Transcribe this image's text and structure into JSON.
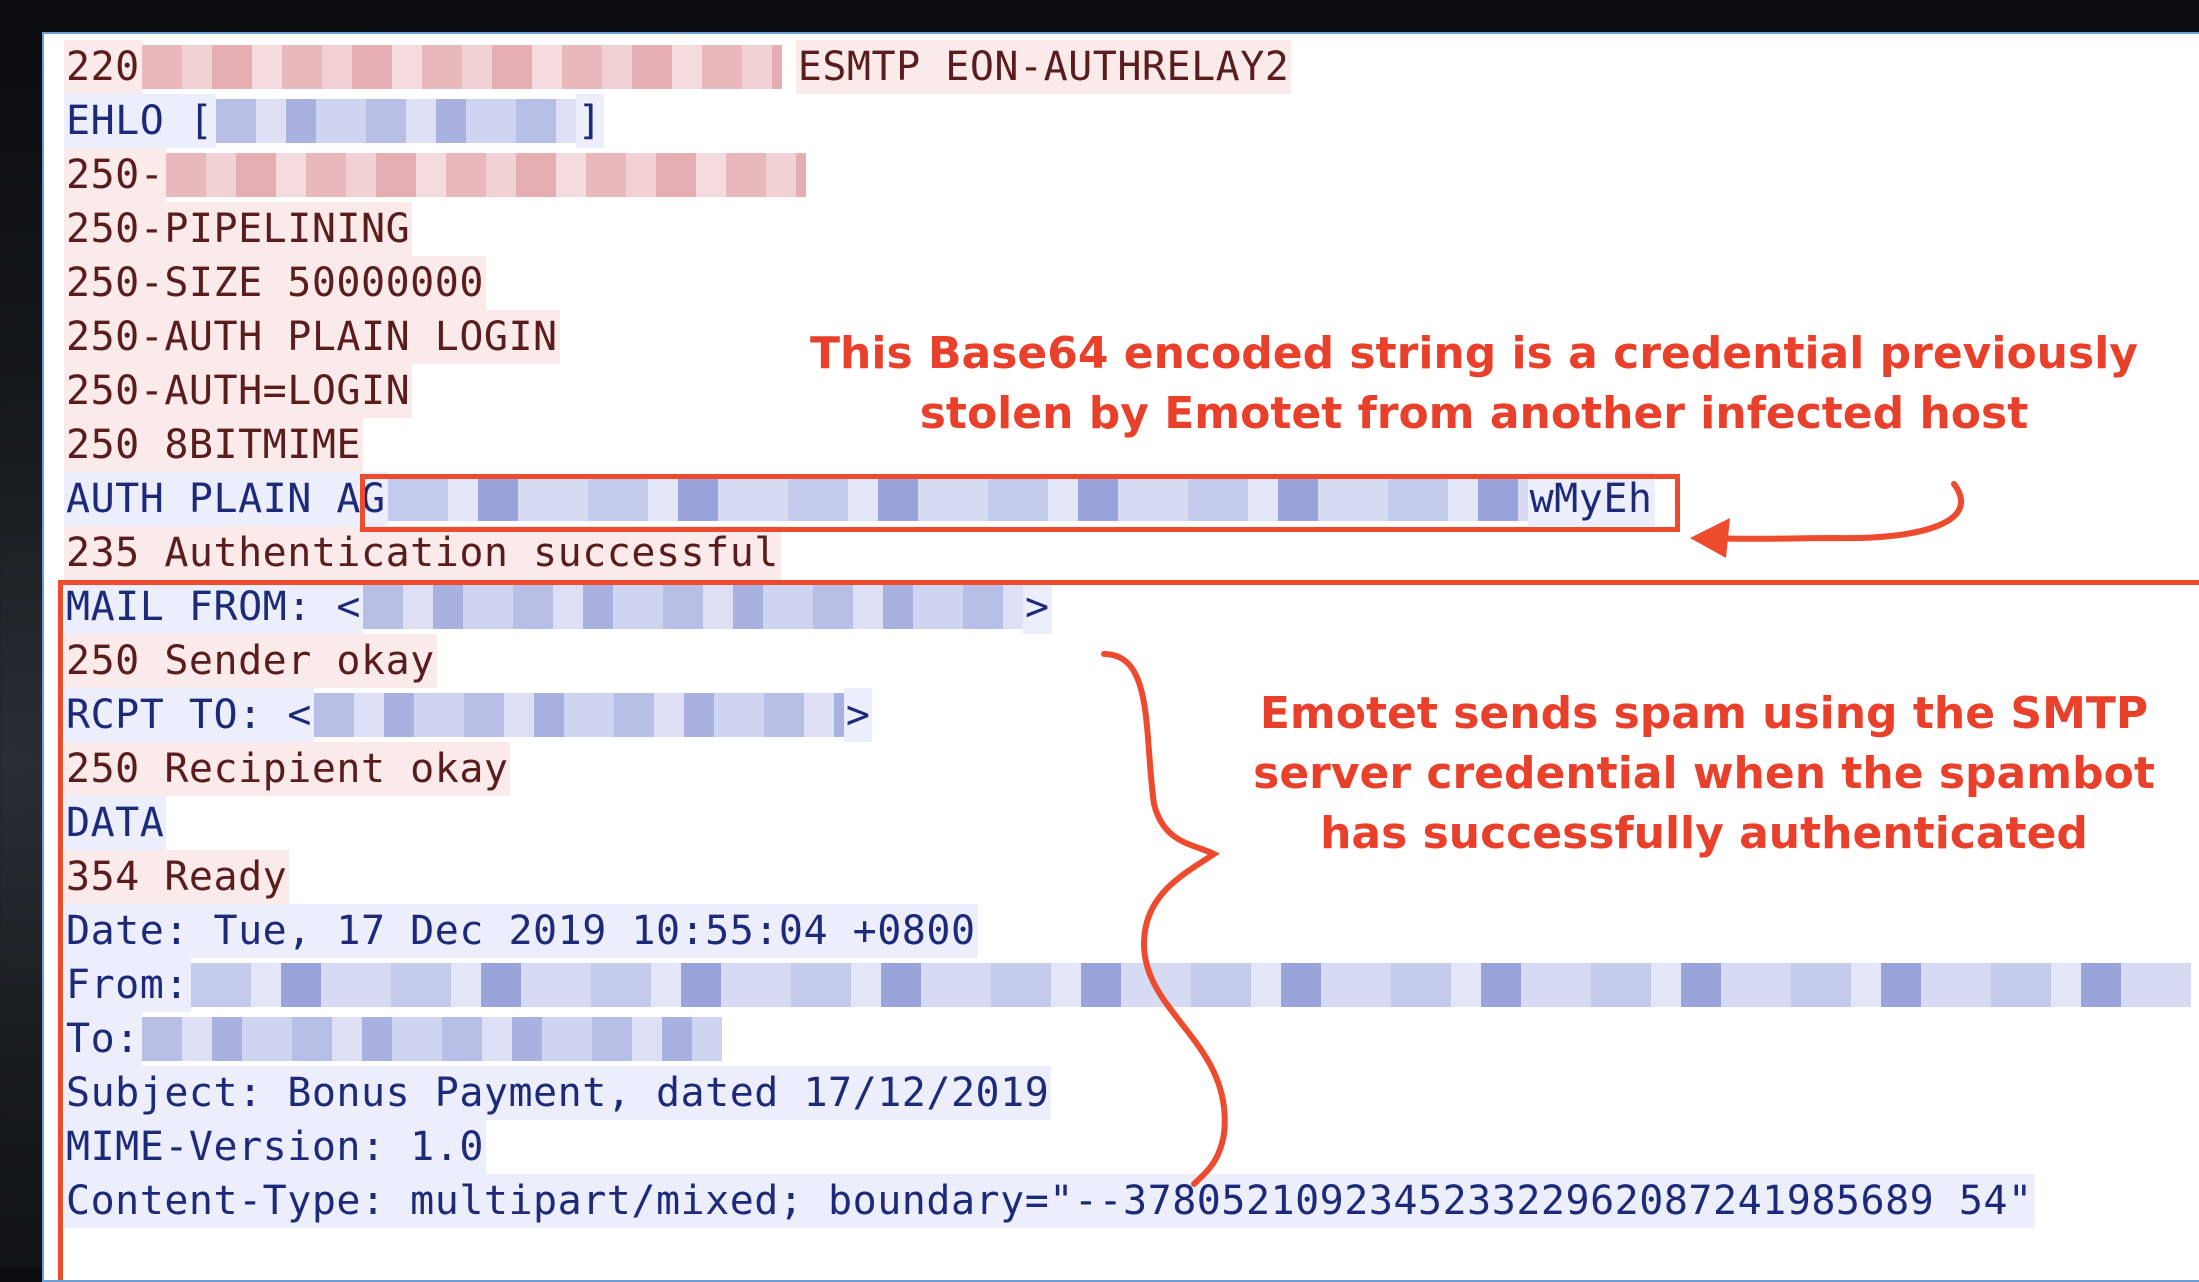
{
  "smtp_session": {
    "lines": [
      {
        "role": "server",
        "parts": [
          "220 ",
          "ESMTP EON-AUTHRELAY2"
        ]
      },
      {
        "role": "client",
        "parts": [
          "EHLO [",
          "]"
        ]
      },
      {
        "role": "server",
        "parts": [
          "250-"
        ]
      },
      {
        "role": "server",
        "parts": [
          "250-PIPELINING"
        ]
      },
      {
        "role": "server",
        "parts": [
          "250-SIZE 50000000"
        ]
      },
      {
        "role": "server",
        "parts": [
          "250-AUTH PLAIN LOGIN"
        ]
      },
      {
        "role": "server",
        "parts": [
          "250-AUTH=LOGIN"
        ]
      },
      {
        "role": "server",
        "parts": [
          "250 8BITMIME"
        ]
      },
      {
        "role": "client",
        "parts": [
          "AUTH PLAIN AG",
          "wMyEh"
        ]
      },
      {
        "role": "server",
        "parts": [
          "235 Authentication successful"
        ]
      },
      {
        "role": "client",
        "parts": [
          "MAIL FROM: <",
          ">"
        ]
      },
      {
        "role": "server",
        "parts": [
          "250 Sender okay"
        ]
      },
      {
        "role": "client",
        "parts": [
          "RCPT TO: <",
          ">"
        ]
      },
      {
        "role": "server",
        "parts": [
          "250 Recipient okay"
        ]
      },
      {
        "role": "client",
        "parts": [
          "DATA"
        ]
      },
      {
        "role": "server",
        "parts": [
          "354 Ready"
        ]
      },
      {
        "role": "client",
        "parts": [
          "Date: Tue, 17 Dec 2019 10:55:04 +0800"
        ]
      },
      {
        "role": "client",
        "parts": [
          "From: "
        ]
      },
      {
        "role": "client",
        "parts": [
          "To: "
        ]
      },
      {
        "role": "client",
        "parts": [
          "Subject: Bonus Payment, dated 17/12/2019"
        ]
      },
      {
        "role": "client",
        "parts": [
          "MIME-Version: 1.0"
        ]
      },
      {
        "role": "client",
        "parts": [
          "Content-Type: multipart/mixed; boundary=\"--378052109234523322962087241985689 54\""
        ]
      }
    ]
  },
  "annotations": {
    "credential_note_line1": "This Base64 encoded string is a credential previously",
    "credential_note_line2": "stolen by Emotet from another infected host",
    "spam_note_line1": "Emotet sends spam using the SMTP",
    "spam_note_line2": "server credential when the spambot",
    "spam_note_line3": "has successfully authenticated"
  },
  "colors": {
    "annotation_red": "#e8402a",
    "server_text": "#5a1c1c",
    "client_text": "#1d2a7a",
    "panel_border": "#6b9ed6"
  }
}
